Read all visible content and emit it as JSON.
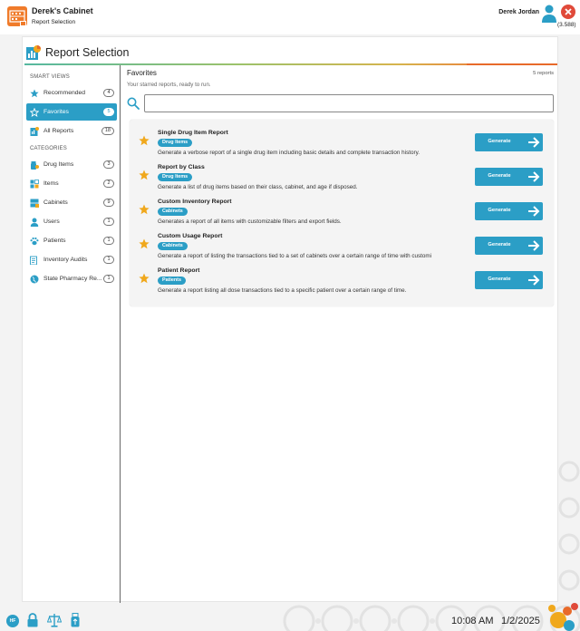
{
  "header": {
    "app_title": "Derek's Cabinet",
    "app_subtitle": "Report Selection",
    "user_name": "Derek Jordan",
    "version": "(3.588)"
  },
  "panel": {
    "title": "Report Selection"
  },
  "sidebar": {
    "smart_views_label": "SMART VIEWS",
    "categories_label": "CATEGORIES",
    "smart_views": [
      {
        "label": "Recommended",
        "count": "4",
        "icon": "star-icon"
      },
      {
        "label": "Favorites",
        "count": "5",
        "icon": "star-outline-icon",
        "active": true
      },
      {
        "label": "All Reports",
        "count": "18",
        "icon": "report-icon"
      }
    ],
    "categories": [
      {
        "label": "Drug Items",
        "count": "3",
        "icon": "pill-icon"
      },
      {
        "label": "Items",
        "count": "2",
        "icon": "items-icon"
      },
      {
        "label": "Cabinets",
        "count": "9",
        "icon": "cabinet-icon"
      },
      {
        "label": "Users",
        "count": "1",
        "icon": "user-icon"
      },
      {
        "label": "Patients",
        "count": "1",
        "icon": "paw-icon"
      },
      {
        "label": "Inventory Audits",
        "count": "1",
        "icon": "audit-icon"
      },
      {
        "label": "State Pharmacy Re...",
        "count": "1",
        "icon": "globe-icon"
      }
    ]
  },
  "content": {
    "title": "Favorites",
    "count_label": "5 reports",
    "subtitle": "Your starred reports, ready to run.",
    "search": {
      "value": "",
      "placeholder": ""
    },
    "generate_label": "Generate",
    "reports": [
      {
        "title": "Single Drug Item Report",
        "tag": "Drug Items",
        "description": "Generate a verbose report of a single drug item including basic details and complete transaction history."
      },
      {
        "title": "Report by Class",
        "tag": "Drug Items",
        "description": "Generate a list of drug items based on their class, cabinet, and age if disposed."
      },
      {
        "title": "Custom Inventory Report",
        "tag": "Cabinets",
        "description": "Generates a report of all items with customizable filters and export fields."
      },
      {
        "title": "Custom Usage Report",
        "tag": "Cabinets",
        "description": "Generate a report of listing the transactions tied to a set of cabinets over a certain range of time with customi"
      },
      {
        "title": "Patient Report",
        "tag": "Patients",
        "description": "Generate a report listing all dose transactions tied to a specific patient over a certain range of time."
      }
    ]
  },
  "footer": {
    "badge": "HF",
    "time": "10:08 AM",
    "date": "1/2/2025"
  },
  "colors": {
    "accent": "#2b9ec6",
    "star": "#f0a81c",
    "close": "#e04a3a",
    "logo": "#f07b2a"
  }
}
